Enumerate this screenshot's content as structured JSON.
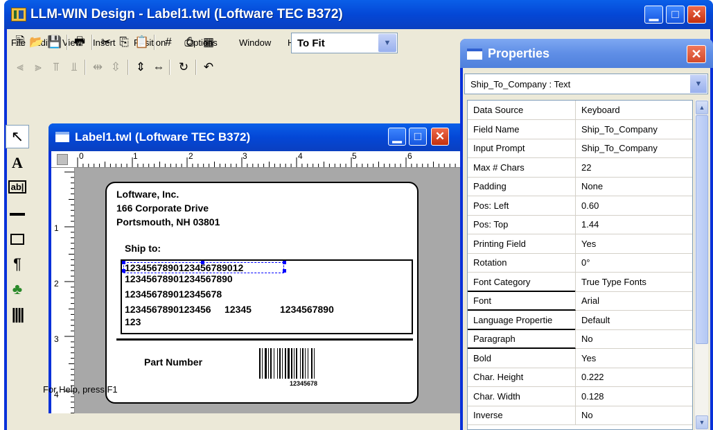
{
  "main_window": {
    "title": "LLM-WIN Design - Label1.twl (Loftware TEC B372)",
    "menu": [
      "File",
      "Edit",
      "View",
      "Insert",
      "Position",
      "Options",
      "Window",
      "Help"
    ],
    "zoom_value": "To Fit"
  },
  "child_window": {
    "title": "Label1.twl (Loftware TEC B372)",
    "ruler_top": [
      "0",
      "1",
      "2",
      "3",
      "4",
      "5",
      "6"
    ],
    "ruler_left": [
      "1",
      "2",
      "3",
      "4"
    ]
  },
  "label": {
    "company": "Loftware, Inc.",
    "address1": "166 Corporate Drive",
    "address2": "Portsmouth, NH 03801",
    "ship_to": "Ship to:",
    "line1": "123456789012345678901 2",
    "line1_a": "1234567890123456789012",
    "line2": "12345678901234567890",
    "line3": "123456789012345678",
    "line4a": "1234567890123456",
    "line4b": "12345",
    "line4c": "1234567890",
    "line5": "123",
    "part_number": "Part Number",
    "barcode_text": "12345678"
  },
  "status": {
    "text": "For Help, press F1"
  },
  "properties": {
    "title": "Properties",
    "object": "Ship_To_Company : Text",
    "rows": [
      {
        "name": "Data Source",
        "value": "Keyboard"
      },
      {
        "name": "Field Name",
        "value": "Ship_To_Company"
      },
      {
        "name": "Input Prompt",
        "value": "Ship_To_Company"
      },
      {
        "name": "Max # Chars",
        "value": "22"
      },
      {
        "name": "Padding",
        "value": "None"
      },
      {
        "name": "Pos: Left",
        "value": "0.60"
      },
      {
        "name": "Pos: Top",
        "value": "1.44"
      },
      {
        "name": "Printing Field",
        "value": "Yes"
      },
      {
        "name": "Rotation",
        "value": "0°"
      },
      {
        "name": "Font Category",
        "value": "True Type Fonts"
      },
      {
        "name": "Font",
        "value": "Arial"
      },
      {
        "name": "Language Propertie",
        "value": "Default"
      },
      {
        "name": "Paragraph",
        "value": "No"
      },
      {
        "name": "Bold",
        "value": "Yes"
      },
      {
        "name": "Char. Height",
        "value": "0.222"
      },
      {
        "name": "Char. Width",
        "value": "0.128"
      },
      {
        "name": "Inverse",
        "value": "No"
      }
    ]
  },
  "icons": {
    "minimize": "minimize-icon",
    "maximize": "maximize-icon",
    "close": "close-icon"
  }
}
